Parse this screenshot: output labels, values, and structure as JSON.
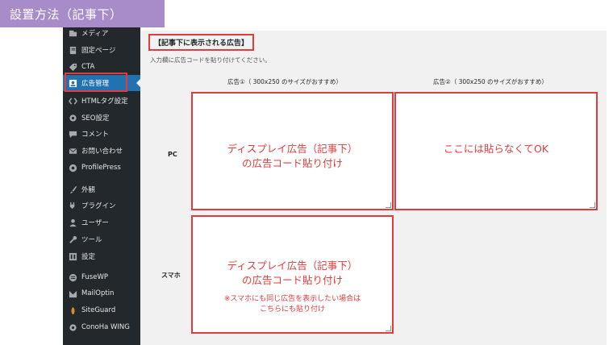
{
  "banner": {
    "title": "設置方法（記事下）"
  },
  "sidebar": {
    "items": [
      {
        "label": "メディア",
        "icon": "media-icon"
      },
      {
        "label": "固定ページ",
        "icon": "page-icon"
      },
      {
        "label": "CTA",
        "icon": "tag-icon"
      },
      {
        "label": "広告管理",
        "icon": "ad-manager-icon",
        "active": true
      },
      {
        "label": "HTMLタグ設定",
        "icon": "code-icon"
      },
      {
        "label": "SEO設定",
        "icon": "gear-icon"
      },
      {
        "label": "コメント",
        "icon": "comment-icon"
      },
      {
        "label": "お問い合わせ",
        "icon": "mail-icon"
      },
      {
        "label": "ProfilePress",
        "icon": "profilepress-icon"
      },
      {
        "label": "外観",
        "icon": "brush-icon"
      },
      {
        "label": "プラグイン",
        "icon": "plugin-icon"
      },
      {
        "label": "ユーザー",
        "icon": "user-icon"
      },
      {
        "label": "ツール",
        "icon": "wrench-icon"
      },
      {
        "label": "設定",
        "icon": "settings-icon"
      },
      {
        "label": "FuseWP",
        "icon": "fusewp-icon"
      },
      {
        "label": "MailOptin",
        "icon": "mailoptin-icon"
      },
      {
        "label": "SiteGuard",
        "icon": "siteguard-icon"
      },
      {
        "label": "ConoHa WING",
        "icon": "conoha-icon"
      }
    ]
  },
  "content": {
    "section_title": "【記事下に表示される広告】",
    "instruction": "入力欄に広告コードを貼り付けてください。",
    "col1_header": "広告①（ 300x250 のサイズがおすすめ）",
    "col2_header": "広告②（ 300x250 のサイズがおすすめ）",
    "row_pc": "PC",
    "row_sp": "スマホ",
    "pc_box1": {
      "line1": "ディスプレイ広告（記事下）",
      "line2": "の広告コード貼り付け"
    },
    "pc_box2": {
      "line1": "ここには貼らなくてOK"
    },
    "sp_box1": {
      "line1": "ディスプレイ広告（記事下）",
      "line2": "の広告コード貼り付け",
      "note1": "※スマホにも同じ広告を表示したい場合は",
      "note2": "こちらにも貼り付け"
    }
  },
  "colors": {
    "accent_red": "#e23b3b",
    "banner": "#a88cc9",
    "sidebar": "#23282d",
    "active": "#2271b1"
  }
}
